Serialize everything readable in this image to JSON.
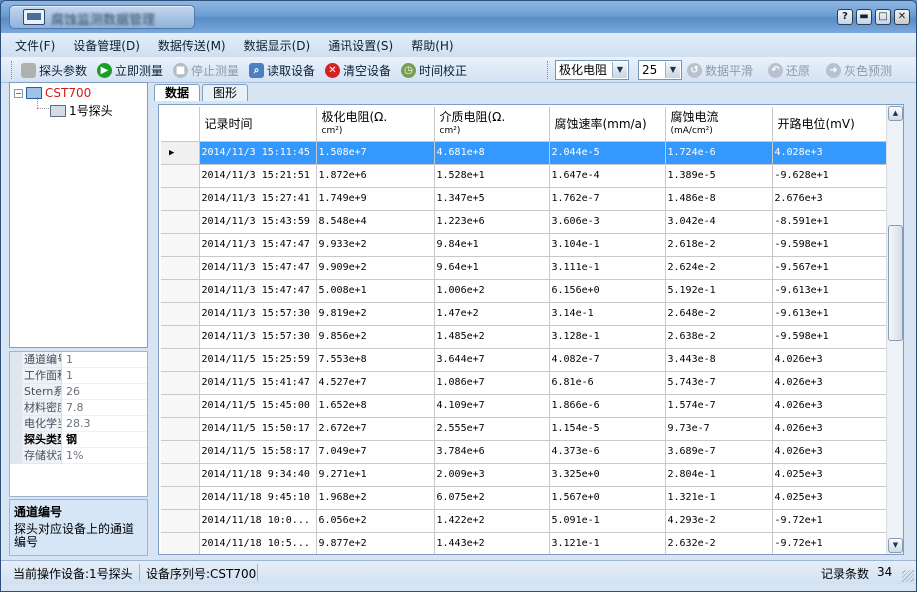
{
  "window": {
    "title": "腐蚀监测数据管理"
  },
  "menu": {
    "items": [
      "文件(F)",
      "设备管理(D)",
      "数据传送(M)",
      "数据显示(D)",
      "通讯设置(S)",
      "帮助(H)"
    ]
  },
  "toolbar": {
    "probe_params": "探头参数",
    "measure_now": "立即测量",
    "stop_measure": "停止测量",
    "read_device": "读取设备",
    "clear_device": "清空设备",
    "time_sync": "时间校正",
    "param_select": "极化电阻",
    "count_select": "25",
    "smooth": "数据平滑",
    "restore": "还原",
    "gray_predict": "灰色预测"
  },
  "tree": {
    "root_label": "CST700",
    "child_label": "1号探头"
  },
  "properties": [
    {
      "key": "通道编号",
      "value": "1",
      "active": false
    },
    {
      "key": "工作面积",
      "value": "1",
      "active": false
    },
    {
      "key": "Stern系数",
      "value": "26",
      "active": false
    },
    {
      "key": "材料密度",
      "value": "7.8",
      "active": false
    },
    {
      "key": "电化学当量",
      "value": "28.3",
      "active": false
    },
    {
      "key": "探头类型",
      "value": "钢",
      "active": true
    },
    {
      "key": "存储状态",
      "value": "1%",
      "active": false
    }
  ],
  "description": {
    "title": "通道编号",
    "text": "探头对应设备上的通道编号"
  },
  "tabs": {
    "data": "数据",
    "graph": "图形"
  },
  "grid": {
    "headers": [
      {
        "label": "记录时间",
        "unit": ""
      },
      {
        "label": "极化电阻(Ω.",
        "unit": "cm²)"
      },
      {
        "label": "介质电阻(Ω.",
        "unit": "cm²)"
      },
      {
        "label": "腐蚀速率(mm/a)",
        "unit": ""
      },
      {
        "label": "腐蚀电流",
        "unit": "(mA/cm²)"
      },
      {
        "label": "开路电位(mV)",
        "unit": ""
      }
    ],
    "rows": [
      [
        "2014/11/3 15:11:45",
        "1.508e+7",
        "4.681e+8",
        "2.044e-5",
        "1.724e-6",
        "4.028e+3"
      ],
      [
        "2014/11/3 15:21:51",
        "1.872e+6",
        "1.528e+1",
        "1.647e-4",
        "1.389e-5",
        "-9.628e+1"
      ],
      [
        "2014/11/3 15:27:41",
        "1.749e+9",
        "1.347e+5",
        "1.762e-7",
        "1.486e-8",
        "2.676e+3"
      ],
      [
        "2014/11/3 15:43:59",
        "8.548e+4",
        "1.223e+6",
        "3.606e-3",
        "3.042e-4",
        "-8.591e+1"
      ],
      [
        "2014/11/3 15:47:47",
        "9.933e+2",
        "9.84e+1",
        "3.104e-1",
        "2.618e-2",
        "-9.598e+1"
      ],
      [
        "2014/11/3 15:47:47",
        "9.909e+2",
        "9.64e+1",
        "3.111e-1",
        "2.624e-2",
        "-9.567e+1"
      ],
      [
        "2014/11/3 15:47:47",
        "5.008e+1",
        "1.006e+2",
        "6.156e+0",
        "5.192e-1",
        "-9.613e+1"
      ],
      [
        "2014/11/3 15:57:30",
        "9.819e+2",
        "1.47e+2",
        "3.14e-1",
        "2.648e-2",
        "-9.613e+1"
      ],
      [
        "2014/11/3 15:57:30",
        "9.856e+2",
        "1.485e+2",
        "3.128e-1",
        "2.638e-2",
        "-9.598e+1"
      ],
      [
        "2014/11/5 15:25:59",
        "7.553e+8",
        "3.644e+7",
        "4.082e-7",
        "3.443e-8",
        "4.026e+3"
      ],
      [
        "2014/11/5 15:41:47",
        "4.527e+7",
        "1.086e+7",
        "6.81e-6",
        "5.743e-7",
        "4.026e+3"
      ],
      [
        "2014/11/5 15:45:00",
        "1.652e+8",
        "4.109e+7",
        "1.866e-6",
        "1.574e-7",
        "4.026e+3"
      ],
      [
        "2014/11/5 15:50:17",
        "2.672e+7",
        "2.555e+7",
        "1.154e-5",
        "9.73e-7",
        "4.026e+3"
      ],
      [
        "2014/11/5 15:58:17",
        "7.049e+7",
        "3.784e+6",
        "4.373e-6",
        "3.689e-7",
        "4.026e+3"
      ],
      [
        "2014/11/18 9:34:40",
        "9.271e+1",
        "2.009e+3",
        "3.325e+0",
        "2.804e-1",
        "4.025e+3"
      ],
      [
        "2014/11/18 9:45:10",
        "1.968e+2",
        "6.075e+2",
        "1.567e+0",
        "1.321e-1",
        "4.025e+3"
      ],
      [
        "2014/11/18 10:0...",
        "6.056e+2",
        "1.422e+2",
        "5.091e-1",
        "4.293e-2",
        "-9.72e+1"
      ],
      [
        "2014/11/18 10:5...",
        "9.877e+2",
        "1.443e+2",
        "3.121e-1",
        "2.632e-2",
        "-9.72e+1"
      ]
    ]
  },
  "status": {
    "current_device": "当前操作设备:1号探头",
    "serial": "设备序列号:CST700",
    "record_count_label": "记录条数",
    "record_count": "34"
  }
}
